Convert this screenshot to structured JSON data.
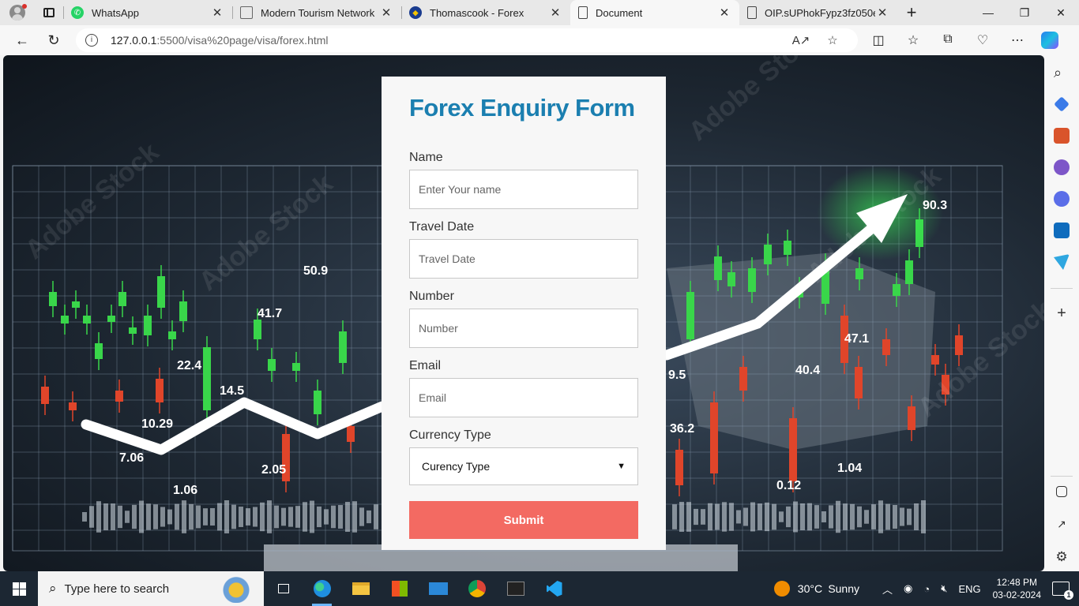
{
  "browser": {
    "tabs": [
      {
        "title": "WhatsApp",
        "icon": "whatsapp-icon"
      },
      {
        "title": "Modern Tourism Network",
        "icon": "image-icon"
      },
      {
        "title": "Thomascook - Forex",
        "icon": "thomascook-icon"
      },
      {
        "title": "Document",
        "icon": "document-icon",
        "active": true
      },
      {
        "title": "OIP.sUPhokFypz3fz050e3MI",
        "icon": "document-icon"
      }
    ],
    "url_host": "127.0.0.1",
    "url_path": ":5500/visa%20page/visa/forex.html"
  },
  "background": {
    "labels": [
      "50.9",
      "41.7",
      "22.4",
      "14.5",
      "10.29",
      "7.06",
      "2.05",
      "1.06",
      "9.5",
      "36.2",
      "40.4",
      "47.1",
      "90.3",
      "0.12",
      "1.04"
    ],
    "watermark": "Adobe Stock"
  },
  "form": {
    "title": "Forex Enquiry Form",
    "name_label": "Name",
    "name_placeholder": "Enter Your name",
    "date_label": "Travel Date",
    "date_placeholder": "Travel Date",
    "number_label": "Number",
    "number_placeholder": "Number",
    "email_label": "Email",
    "email_placeholder": "Email",
    "currency_label": "Currency Type",
    "currency_selected": "Curency Type",
    "submit_label": "Submit",
    "accent_color": "#1b7fb0",
    "button_color": "#f36a62"
  },
  "taskbar": {
    "search_placeholder": "Type here to search",
    "weather_temp": "30°C",
    "weather_text": "Sunny",
    "language": "ENG",
    "time": "12:48 PM",
    "date": "03-02-2024",
    "notification_count": "1"
  }
}
